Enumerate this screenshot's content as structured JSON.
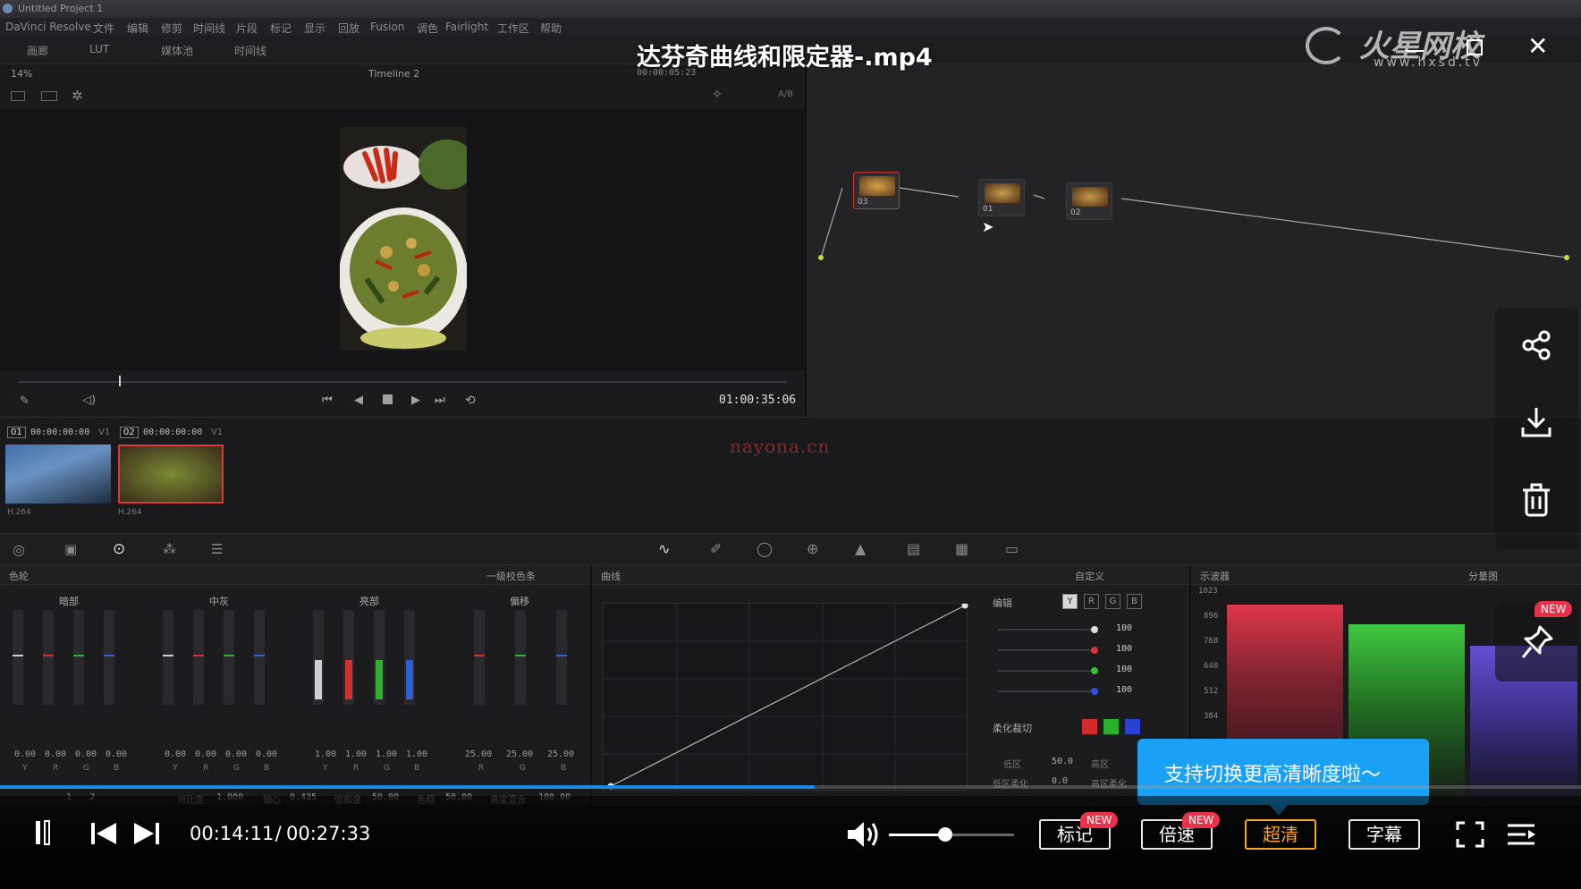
{
  "video": {
    "title": "达芬奇曲线和限定器-.mp4",
    "current_time": "00:14:11",
    "total_time": "00:27:33",
    "time_separator": " / ",
    "progress": 0.515,
    "volume": 0.45,
    "watermark_brand": "火星网校",
    "watermark_url": "www.hxsd.tv",
    "center_watermark": "nayona.cn"
  },
  "player": {
    "buttons": {
      "mark": "标记",
      "speed": "倍速",
      "hd": "超清",
      "subtitle": "字幕"
    },
    "new_badge": "NEW",
    "tooltip": "支持切换更高清晰度啦～",
    "side_actions": [
      "share-icon",
      "download-icon",
      "delete-icon",
      "pin-icon"
    ]
  },
  "resolve": {
    "window_title": "Untitled Project 1",
    "menu": [
      "DaVinci Resolve",
      "文件",
      "编辑",
      "修剪",
      "时间线",
      "片段",
      "标记",
      "显示",
      "回放",
      "Fusion",
      "调色",
      "Fairlight",
      "工作区",
      "帮助"
    ],
    "toolbar": [
      "画廊",
      "LUT",
      "媒体池",
      "时间线"
    ],
    "zoom": "14%",
    "timeline_name": "Timeline 2",
    "viewer_timecode": "00:00:05:23",
    "ab_label": "A/B",
    "playhead_timecode": "01:00:35:06",
    "nodes": [
      {
        "id": "03",
        "label": "03"
      },
      {
        "id": "01",
        "label": "01"
      },
      {
        "id": "02",
        "label": "02"
      }
    ],
    "clips": [
      {
        "num": "01",
        "tc": "00:00:00:00",
        "track": "V1",
        "codec": "H.264"
      },
      {
        "num": "02",
        "tc": "00:00:00:00",
        "track": "V1",
        "codec": "H.264"
      }
    ],
    "wheels_panel": {
      "title": "色轮",
      "mode": "一级校色条",
      "groups": [
        {
          "name": "暗部",
          "values": [
            "0.00",
            "0.00",
            "0.00",
            "0.00"
          ],
          "channels": [
            "Y",
            "R",
            "G",
            "B"
          ]
        },
        {
          "name": "中灰",
          "values": [
            "0.00",
            "0.00",
            "0.00",
            "0.00"
          ],
          "channels": [
            "Y",
            "R",
            "G",
            "B"
          ]
        },
        {
          "name": "亮部",
          "values": [
            "1.00",
            "1.00",
            "1.00",
            "1.00"
          ],
          "channels": [
            "Y",
            "R",
            "G",
            "B"
          ]
        },
        {
          "name": "偏移",
          "values": [
            "25.00",
            "25.00",
            "25.00"
          ],
          "channels": [
            "R",
            "G",
            "B"
          ]
        }
      ],
      "footer": [
        {
          "label": "对比度",
          "value": "1.000"
        },
        {
          "label": "轴心",
          "value": "0.435"
        },
        {
          "label": "饱和度",
          "value": "50.00"
        },
        {
          "label": "色相",
          "value": "50.00"
        },
        {
          "label": "亮度混合",
          "value": "100.00"
        }
      ],
      "pages": [
        "1",
        "2"
      ]
    },
    "curves_panel": {
      "title": "曲线",
      "mode": "自定义",
      "edit_label": "编辑",
      "channels": [
        "Y",
        "R",
        "G",
        "B"
      ],
      "intensity": [
        "100",
        "100",
        "100",
        "100"
      ],
      "soft_clip_label": "柔化裁切",
      "low_label": "低区",
      "low_value": "50.0",
      "high_label": "高区",
      "low_soft_label": "低区柔化",
      "low_soft_value": "0.0",
      "high_soft_label": "高区柔化"
    },
    "scopes_panel": {
      "title": "示波器",
      "mode": "分量图",
      "axis": [
        "1023",
        "896",
        "768",
        "640",
        "512",
        "384"
      ]
    },
    "colors": {
      "accent": "#1e88e5",
      "tooltip_bg": "#1aa1f5",
      "new_badge": "#e9314a",
      "hd_button": "#f5a623"
    }
  }
}
